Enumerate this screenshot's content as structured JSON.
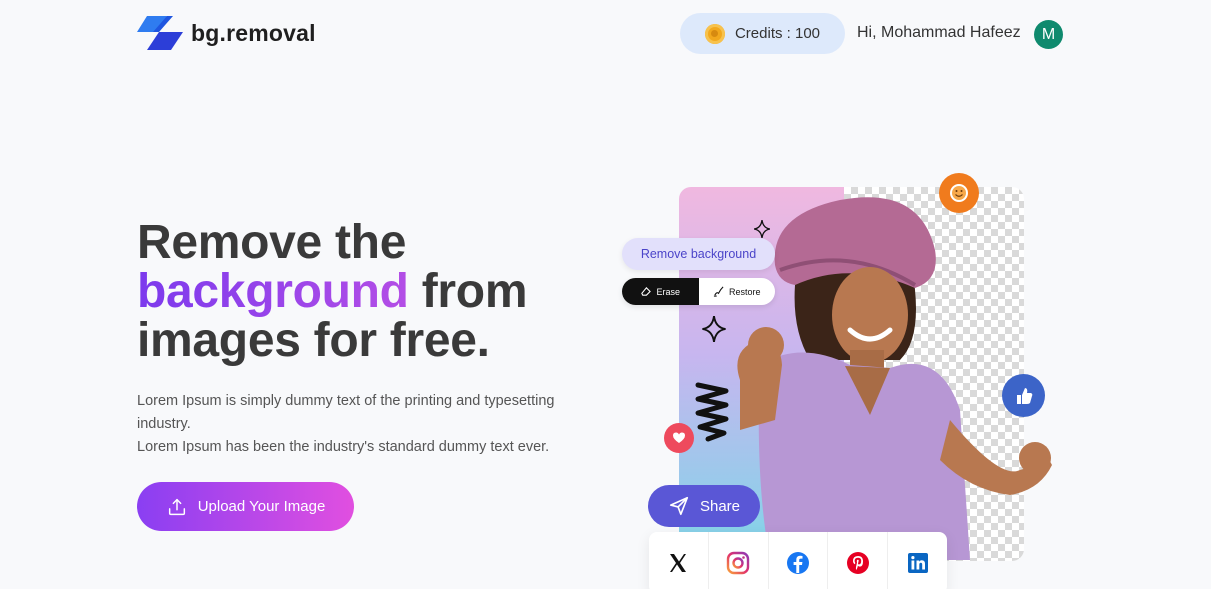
{
  "header": {
    "logo_text": "bg.removal",
    "credits_label": "Credits : 100",
    "greeting": "Hi, Mohammad Hafeez",
    "avatar_initial": "M"
  },
  "hero": {
    "title_line1": "Remove the",
    "title_accent": "background",
    "title_after_accent": " from",
    "title_line3": "images for free.",
    "description_line1": "Lorem Ipsum is simply dummy text of the printing and typesetting industry.",
    "description_line2": "Lorem Ipsum has been the industry's standard dummy text ever.",
    "upload_label": "Upload Your Image"
  },
  "editor": {
    "remove_bg_label": "Remove background",
    "erase_label": "Erase",
    "restore_label": "Restore",
    "share_label": "Share"
  },
  "social": [
    "x-icon",
    "instagram-icon",
    "facebook-icon",
    "pinterest-icon",
    "linkedin-icon"
  ],
  "colors": {
    "accent_purple": "#8a3ff2",
    "accent_pink": "#e14fe0",
    "share_blue": "#5a57d6",
    "avatar_green": "#0f8a6e",
    "credits_bg": "#dde9fb"
  }
}
